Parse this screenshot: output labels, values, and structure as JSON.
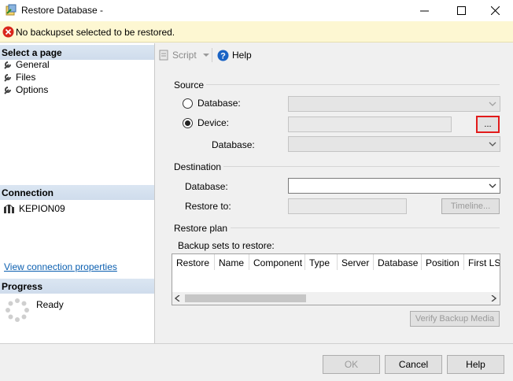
{
  "window": {
    "title": "Restore Database -",
    "app_icon": "database-restore-icon"
  },
  "error_bar": {
    "icon": "error-circle-icon",
    "message": "No backupset selected to be restored."
  },
  "left_panel": {
    "select_page_header": "Select a page",
    "pages": [
      {
        "label": "General",
        "icon": "wrench-icon",
        "selected": true
      },
      {
        "label": "Files",
        "icon": "wrench-icon",
        "selected": false
      },
      {
        "label": "Options",
        "icon": "wrench-icon",
        "selected": false
      }
    ],
    "connection_header": "Connection",
    "connection_server": "KEPION09",
    "view_connection_link": "View connection properties",
    "progress_header": "Progress",
    "progress_status": "Ready"
  },
  "toolbar": {
    "script_label": "Script",
    "help_label": "Help"
  },
  "source": {
    "group_label": "Source",
    "database_radio_label": "Database:",
    "device_radio_label": "Device:",
    "selected_option": "Device",
    "database_sub_label": "Database:",
    "device_value": "",
    "browse_label": "..."
  },
  "destination": {
    "group_label": "Destination",
    "database_label": "Database:",
    "database_value": "",
    "restore_to_label": "Restore to:",
    "restore_to_value": "",
    "timeline_button": "Timeline..."
  },
  "restore_plan": {
    "group_label": "Restore plan",
    "backup_sets_label": "Backup sets to restore:",
    "columns": [
      "Restore",
      "Name",
      "Component",
      "Type",
      "Server",
      "Database",
      "Position",
      "First LSN"
    ],
    "rows": [],
    "verify_button": "Verify Backup Media"
  },
  "footer": {
    "ok_label": "OK",
    "cancel_label": "Cancel",
    "help_label": "Help"
  },
  "colors": {
    "error_bar_bg": "#fdf7d2",
    "section_header_bg": "#d5e1ef",
    "highlight_border": "#e21b1b",
    "link": "#0b5fb0"
  }
}
